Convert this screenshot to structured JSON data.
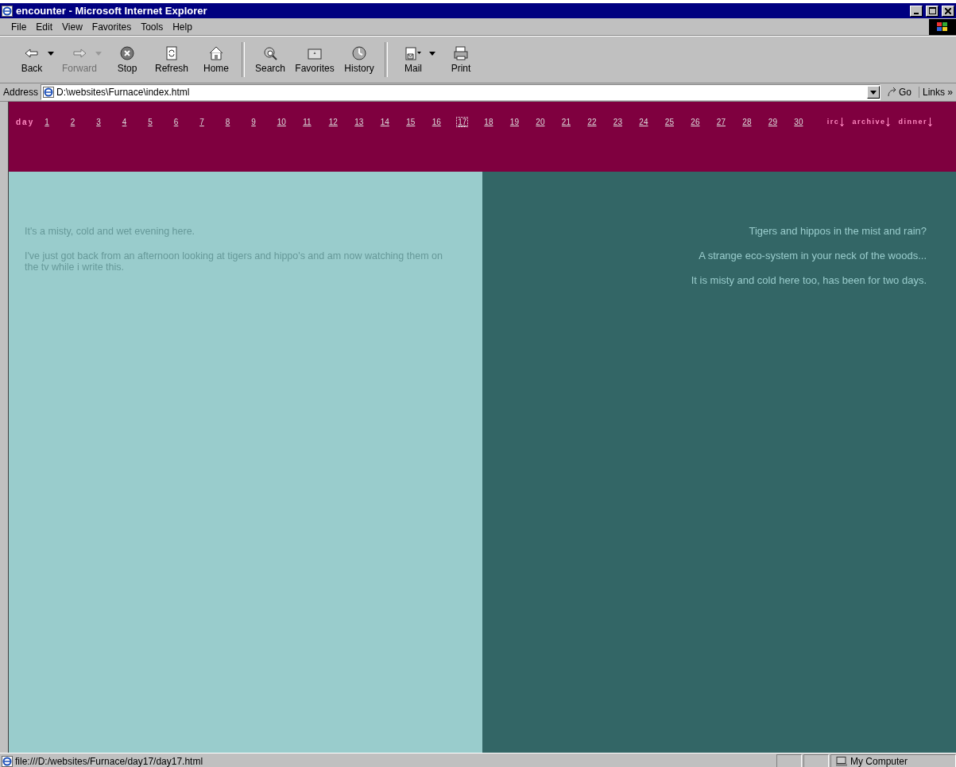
{
  "window": {
    "title": "encounter - Microsoft Internet Explorer"
  },
  "menu": [
    "File",
    "Edit",
    "View",
    "Favorites",
    "Tools",
    "Help"
  ],
  "toolbar": [
    {
      "label": "Back",
      "disabled": false,
      "dropdown": true
    },
    {
      "label": "Forward",
      "disabled": true,
      "dropdown": true
    },
    {
      "label": "Stop",
      "disabled": false,
      "dropdown": false
    },
    {
      "label": "Refresh",
      "disabled": false,
      "dropdown": false
    },
    {
      "label": "Home",
      "disabled": false,
      "dropdown": false
    },
    {
      "label": "Search",
      "disabled": false,
      "dropdown": false
    },
    {
      "label": "Favorites",
      "disabled": false,
      "dropdown": false
    },
    {
      "label": "History",
      "disabled": false,
      "dropdown": false
    },
    {
      "label": "Mail",
      "disabled": false,
      "dropdown": true
    },
    {
      "label": "Print",
      "disabled": false,
      "dropdown": false
    }
  ],
  "address": {
    "label": "Address",
    "value": "D:\\websites\\Furnace\\index.html",
    "go": "Go",
    "links": "Links",
    "more": "»"
  },
  "nav": {
    "label": "day",
    "days": [
      {
        "label": "1",
        "selected": false
      },
      {
        "label": "2",
        "selected": false
      },
      {
        "label": "3",
        "selected": false
      },
      {
        "label": "4",
        "selected": false
      },
      {
        "label": "5",
        "selected": false
      },
      {
        "label": "6",
        "selected": false
      },
      {
        "label": "7",
        "selected": false
      },
      {
        "label": "8",
        "selected": false
      },
      {
        "label": "9",
        "selected": false
      },
      {
        "label": "10",
        "selected": false
      },
      {
        "label": "11",
        "selected": false
      },
      {
        "label": "12",
        "selected": false
      },
      {
        "label": "13",
        "selected": false
      },
      {
        "label": "14",
        "selected": false
      },
      {
        "label": "15",
        "selected": false
      },
      {
        "label": "16",
        "selected": false
      },
      {
        "label": "17",
        "selected": true
      },
      {
        "label": "18",
        "selected": false
      },
      {
        "label": "19",
        "selected": false
      },
      {
        "label": "20",
        "selected": false
      },
      {
        "label": "21",
        "selected": false
      },
      {
        "label": "22",
        "selected": false
      },
      {
        "label": "23",
        "selected": false
      },
      {
        "label": "24",
        "selected": false
      },
      {
        "label": "25",
        "selected": false
      },
      {
        "label": "26",
        "selected": false
      },
      {
        "label": "27",
        "selected": false
      },
      {
        "label": "28",
        "selected": false
      },
      {
        "label": "29",
        "selected": false
      },
      {
        "label": "30",
        "selected": false
      }
    ],
    "sections": [
      "irc",
      "archive",
      "dinner"
    ]
  },
  "left_panel": {
    "paragraphs": [
      "It's a misty, cold and wet evening here.",
      "I've just got back from an afternoon looking at tigers and hippo's and am now watching them on the tv while i write this."
    ]
  },
  "right_panel": {
    "paragraphs": [
      "Tigers and hippos in the mist and rain?",
      "A strange eco-system in your neck of the woods...",
      "It is misty and cold here too, has been for two days."
    ]
  },
  "status_bar": {
    "url": "file:///D:/websites/Furnace/day17/day17.html",
    "zone": "My Computer"
  }
}
